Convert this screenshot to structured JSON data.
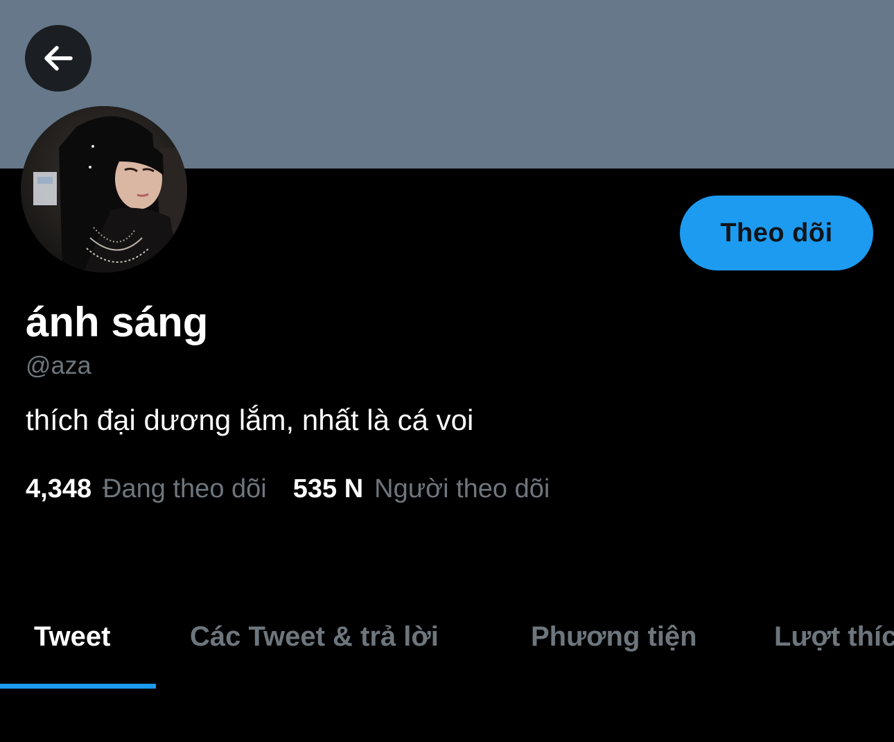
{
  "header": {
    "back_icon": "arrow-left-icon"
  },
  "profile": {
    "display_name": "ánh sáng",
    "handle": "@aza",
    "bio": "thích đại dương lắm, nhất là cá voi",
    "follow_button_label": "Theo dõi",
    "following_count": "4,348",
    "following_label": "Đang theo dõi",
    "followers_count": "535 N",
    "followers_label": "Người theo dõi"
  },
  "tabs": [
    {
      "label": "Tweet",
      "active": true
    },
    {
      "label": "Các Tweet & trả lời",
      "active": false
    },
    {
      "label": "Phương tiện",
      "active": false
    },
    {
      "label": "Lượt thích",
      "active": false
    }
  ],
  "colors": {
    "banner": "#66788a",
    "accent": "#1d9bf0",
    "background": "#000000",
    "secondary_text": "#6e767d"
  }
}
